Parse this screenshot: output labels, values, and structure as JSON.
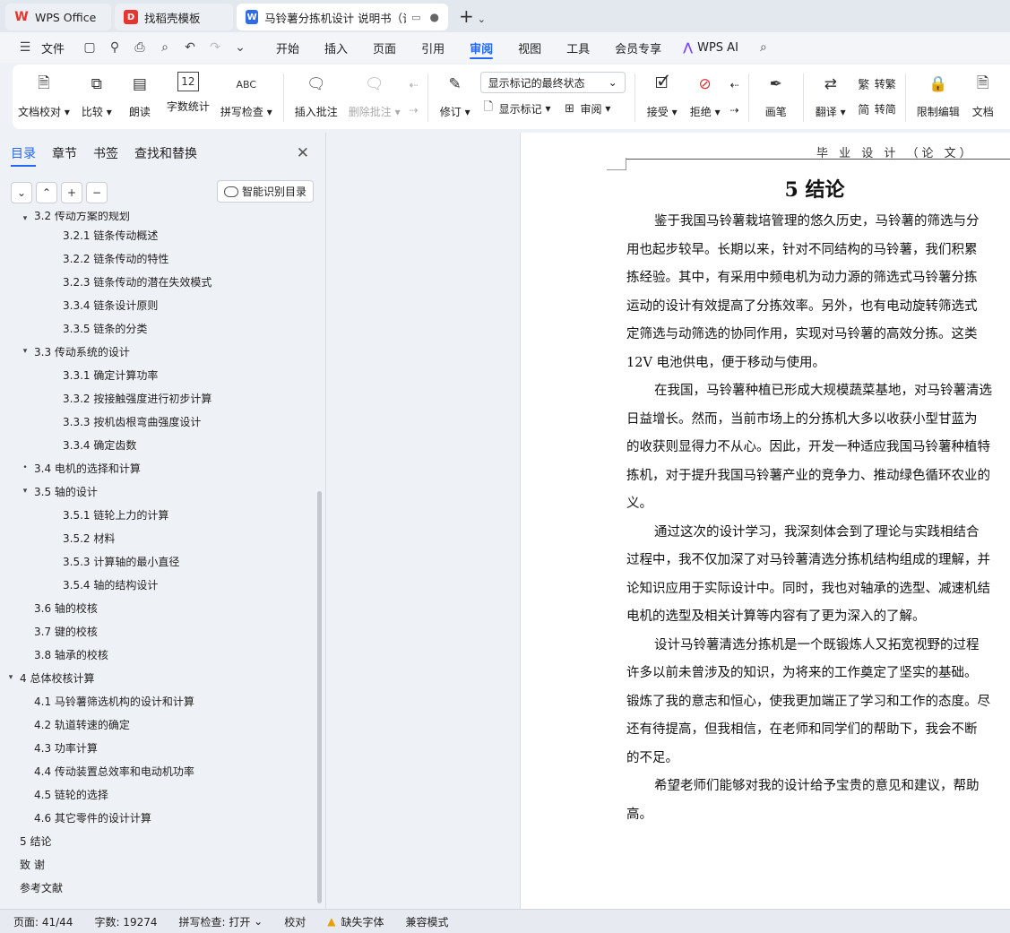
{
  "tabs": [
    {
      "label": "WPS Office",
      "icon": "wps-logo-icon",
      "color": "#e8342e"
    },
    {
      "label": "找稻壳模板",
      "icon": "docer-icon",
      "color": "#e8342e"
    },
    {
      "label": "马铃薯分拣机设计 说明书（论...",
      "icon": "word-doc-icon",
      "color": "#2f6ce5"
    }
  ],
  "menu": {
    "file": "文件",
    "items": [
      "开始",
      "插入",
      "页面",
      "引用",
      "审阅",
      "视图",
      "工具",
      "会员专享"
    ],
    "active": "审阅",
    "wps_ai": "WPS AI"
  },
  "ribbon": {
    "doc_check": "文档校对",
    "compare": "比较",
    "read_aloud": "朗读",
    "word_count": "字数统计",
    "spell_check": "拼写检查",
    "insert_comment": "插入批注",
    "delete_comment": "删除批注",
    "revise": "修订",
    "markup_mode": "显示标记的最终状态",
    "show_markup": "显示标记",
    "review": "审阅",
    "accept": "接受",
    "reject": "拒绝",
    "pen": "画笔",
    "translate": "翻译",
    "to_traditional": "转繁",
    "to_simplified": "转简",
    "restrict_edit": "限制编辑",
    "doc_more": "文档"
  },
  "nav": {
    "tabs": [
      "目录",
      "章节",
      "书签",
      "查找和替换"
    ],
    "active_tab": "目录",
    "smart_toc": "智能识别目录",
    "toc": [
      {
        "text": "3.2 传动方案的规划",
        "level": 2,
        "toggle": "▾"
      },
      {
        "text": "3.2.1  链条传动概述",
        "level": 3,
        "toggle": ""
      },
      {
        "text": "3.2.2  链条传动的特性",
        "level": 3,
        "toggle": ""
      },
      {
        "text": "3.2.3  链条传动的潜在失效模式",
        "level": 3,
        "toggle": ""
      },
      {
        "text": "3.3.4  链条设计原则",
        "level": 3,
        "toggle": ""
      },
      {
        "text": "3.3.5  链条的分类",
        "level": 3,
        "toggle": ""
      },
      {
        "text": "3.3 传动系统的设计",
        "level": 2,
        "toggle": "▾"
      },
      {
        "text": "3.3.1 确定计算功率",
        "level": 3,
        "toggle": ""
      },
      {
        "text": "3.3.2 按接触强度进行初步计算",
        "level": 3,
        "toggle": ""
      },
      {
        "text": "3.3.3 按机齿根弯曲强度设计",
        "level": 3,
        "toggle": ""
      },
      {
        "text": "3.3.4 确定齿数",
        "level": 3,
        "toggle": ""
      },
      {
        "text": "3.4 电机的选择和计算",
        "level": 2,
        "toggle": "•"
      },
      {
        "text": "3.5 轴的设计",
        "level": 2,
        "toggle": "▾"
      },
      {
        "text": "3.5.1 链轮上力的计算",
        "level": 3,
        "toggle": ""
      },
      {
        "text": "3.5.2 材料",
        "level": 3,
        "toggle": ""
      },
      {
        "text": "3.5.3 计算轴的最小直径",
        "level": 3,
        "toggle": ""
      },
      {
        "text": "3.5.4 轴的结构设计",
        "level": 3,
        "toggle": ""
      },
      {
        "text": "3.6 轴的校核",
        "level": 2,
        "toggle": ""
      },
      {
        "text": "3.7 键的校核",
        "level": 2,
        "toggle": ""
      },
      {
        "text": "3.8 轴承的校核",
        "level": 2,
        "toggle": ""
      },
      {
        "text": "4  总体校核计算",
        "level": 1,
        "toggle": "▾"
      },
      {
        "text": "4.1  马铃薯筛选机构的设计和计算",
        "level": 2,
        "toggle": ""
      },
      {
        "text": "4.2  轨道转速的确定",
        "level": 2,
        "toggle": ""
      },
      {
        "text": "4.3  功率计算",
        "level": 2,
        "toggle": ""
      },
      {
        "text": "4.4  传动装置总效率和电动机功率",
        "level": 2,
        "toggle": ""
      },
      {
        "text": "4.5  链轮的选择",
        "level": 2,
        "toggle": ""
      },
      {
        "text": "4.6 其它零件的设计计算",
        "level": 2,
        "toggle": ""
      },
      {
        "text": "5  结论",
        "level": 1,
        "toggle": ""
      },
      {
        "text": "致    谢",
        "level": 1,
        "toggle": ""
      },
      {
        "text": "参考文献",
        "level": 1,
        "toggle": ""
      }
    ]
  },
  "document": {
    "header": "毕 业 设 计 （论 文）",
    "title": "5  结论",
    "lines": [
      {
        "text": "鉴于我国马铃薯栽培管理的悠久历史，马铃薯的筛选与分",
        "indent": true
      },
      {
        "text": "用也起步较早。长期以来，针对不同结构的马铃薯，我们积累",
        "indent": false
      },
      {
        "text": "拣经验。其中，有采用中频电机为动力源的筛选式马铃薯分拣",
        "indent": false
      },
      {
        "text": "运动的设计有效提高了分拣效率。另外，也有电动旋转筛选式",
        "indent": false
      },
      {
        "text": "定筛选与动筛选的协同作用，实现对马铃薯的高效分拣。这类",
        "indent": false
      },
      {
        "text": "12V 电池供电，便于移动与使用。",
        "indent": false
      },
      {
        "text": "在我国，马铃薯种植已形成大规模蔬菜基地，对马铃薯清选",
        "indent": true
      },
      {
        "text": "日益增长。然而，当前市场上的分拣机大多以收获小型甘蓝为",
        "indent": false
      },
      {
        "text": "的收获则显得力不从心。因此，开发一种适应我国马铃薯种植特",
        "indent": false
      },
      {
        "text": "拣机，对于提升我国马铃薯产业的竞争力、推动绿色循环农业的",
        "indent": false
      },
      {
        "text": "义。",
        "indent": false
      },
      {
        "text": "通过这次的设计学习，我深刻体会到了理论与实践相结合",
        "indent": true
      },
      {
        "text": "过程中，我不仅加深了对马铃薯清选分拣机结构组成的理解，并",
        "indent": false
      },
      {
        "text": "论知识应用于实际设计中。同时，我也对轴承的选型、减速机结",
        "indent": false
      },
      {
        "text": "电机的选型及相关计算等内容有了更为深入的了解。",
        "indent": false
      },
      {
        "text": "设计马铃薯清选分拣机是一个既锻炼人又拓宽视野的过程",
        "indent": true
      },
      {
        "text": "许多以前未曾涉及的知识，为将来的工作奠定了坚实的基础。",
        "indent": false
      },
      {
        "text": "锻炼了我的意志和恒心，使我更加端正了学习和工作的态度。尽",
        "indent": false
      },
      {
        "text": "还有待提高，但我相信，在老师和同学们的帮助下，我会不断",
        "indent": false
      },
      {
        "text": "的不足。",
        "indent": false
      },
      {
        "text": "希望老师们能够对我的设计给予宝贵的意见和建议，帮助",
        "indent": true
      },
      {
        "text": "高。",
        "indent": false
      }
    ]
  },
  "status": {
    "page": "页面: 41/44",
    "words": "字数: 19274",
    "spell": "拼写检查: 打开",
    "proof": "校对",
    "missing_font": "缺失字体",
    "compat": "兼容模式"
  },
  "colors": {
    "accent": "#2468f2",
    "warning": "#e8a000"
  }
}
